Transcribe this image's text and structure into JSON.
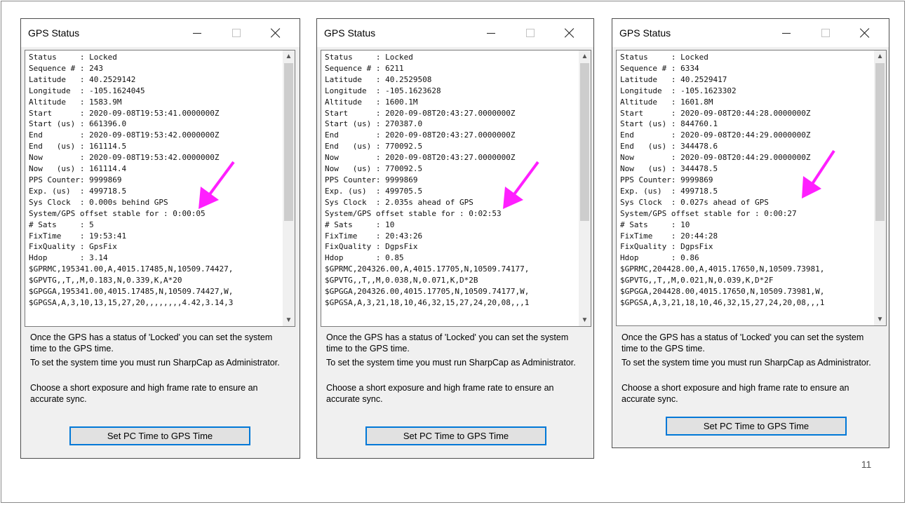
{
  "page_number": "11",
  "colors": {
    "annotation_arrow": "#ff1fff",
    "button_border": "#0078d7"
  },
  "windows": [
    {
      "title": "GPS Status",
      "status_lines": [
        "Status     : Locked",
        "Sequence # : 243",
        "Latitude   : 40.2529142",
        "Longitude  : -105.1624045",
        "Altitude   : 1583.9M",
        "Start      : 2020-09-08T19:53:41.0000000Z",
        "Start (us) : 661396.0",
        "End        : 2020-09-08T19:53:42.0000000Z",
        "End   (us) : 161114.5",
        "Now        : 2020-09-08T19:53:42.0000000Z",
        "Now   (us) : 161114.4",
        "PPS Counter: 9999869",
        "Exp. (us)  : 499718.5",
        "Sys Clock  : 0.000s behind GPS",
        "System/GPS offset stable for : 0:00:05",
        "# Sats     : 5",
        "FixTime    : 19:53:41",
        "FixQuality : GpsFix",
        "Hdop       : 3.14",
        "$GPRMC,195341.00,A,4015.17485,N,10509.74427,",
        "$GPVTG,,T,,M,0.183,N,0.339,K,A*20",
        "$GPGGA,195341.00,4015.17485,N,10509.74427,W,",
        "$GPGSA,A,3,10,13,15,27,20,,,,,,,,4.42,3.14,3"
      ],
      "help_texts": [
        "Once the GPS has a status of 'Locked' you can set the system time to the GPS time.",
        "To set the system time you must run SharpCap as Administrator.",
        "Choose a short exposure and high frame rate to ensure an accurate sync."
      ],
      "button_label": "Set PC Time to GPS Time"
    },
    {
      "title": "GPS Status",
      "status_lines": [
        "Status     : Locked",
        "Sequence # : 6211",
        "Latitude   : 40.2529508",
        "Longitude  : -105.1623628",
        "Altitude   : 1600.1M",
        "Start      : 2020-09-08T20:43:27.0000000Z",
        "Start (us) : 270387.0",
        "End        : 2020-09-08T20:43:27.0000000Z",
        "End   (us) : 770092.5",
        "Now        : 2020-09-08T20:43:27.0000000Z",
        "Now   (us) : 770092.5",
        "PPS Counter: 9999869",
        "Exp. (us)  : 499705.5",
        "Sys Clock  : 2.035s ahead of GPS",
        "System/GPS offset stable for : 0:02:53",
        "# Sats     : 10",
        "FixTime    : 20:43:26",
        "FixQuality : DgpsFix",
        "Hdop       : 0.85",
        "$GPRMC,204326.00,A,4015.17705,N,10509.74177,",
        "$GPVTG,,T,,M,0.038,N,0.071,K,D*2B",
        "$GPGGA,204326.00,4015.17705,N,10509.74177,W,",
        "$GPGSA,A,3,21,18,10,46,32,15,27,24,20,08,,,1"
      ],
      "help_texts": [
        "Once the GPS has a status of 'Locked' you can set the system time to the GPS time.",
        "To set the system time you must run SharpCap as Administrator.",
        "Choose a short exposure and high frame rate to ensure an accurate sync."
      ],
      "button_label": "Set PC Time to GPS Time"
    },
    {
      "title": "GPS Status",
      "status_lines": [
        "Status     : Locked",
        "Sequence # : 6334",
        "Latitude   : 40.2529417",
        "Longitude  : -105.1623302",
        "Altitude   : 1601.8M",
        "Start      : 2020-09-08T20:44:28.0000000Z",
        "Start (us) : 844760.1",
        "End        : 2020-09-08T20:44:29.0000000Z",
        "End   (us) : 344478.6",
        "Now        : 2020-09-08T20:44:29.0000000Z",
        "Now   (us) : 344478.5",
        "PPS Counter: 9999869",
        "Exp. (us)  : 499718.5",
        "Sys Clock  : 0.027s ahead of GPS",
        "System/GPS offset stable for : 0:00:27",
        "# Sats     : 10",
        "FixTime    : 20:44:28",
        "FixQuality : DgpsFix",
        "Hdop       : 0.86",
        "$GPRMC,204428.00,A,4015.17650,N,10509.73981,",
        "$GPVTG,,T,,M,0.021,N,0.039,K,D*2F",
        "$GPGGA,204428.00,4015.17650,N,10509.73981,W,",
        "$GPGSA,A,3,21,18,10,46,32,15,27,24,20,08,,,1"
      ],
      "help_texts": [
        "Once the GPS has a status of 'Locked' you can set the system time to the GPS time.",
        "To set the system time you must run SharpCap as Administrator.",
        "Choose a short exposure and high frame rate to ensure an accurate sync."
      ],
      "button_label": "Set PC Time to GPS Time"
    }
  ]
}
